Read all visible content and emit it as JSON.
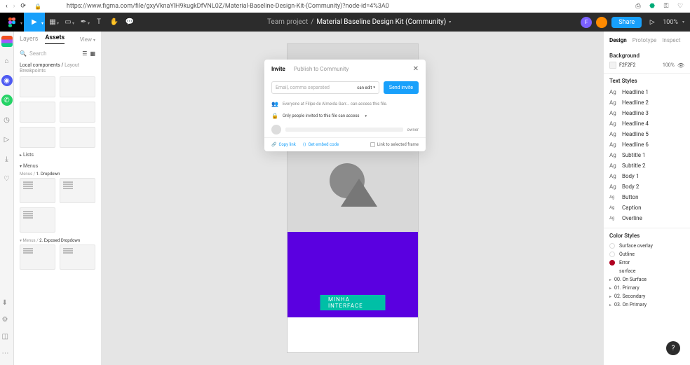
{
  "browser": {
    "url": "https://www.figma.com/file/gxyVknaYlH9kugkDfVNL0Z/Material-Baseline-Design-Kit-(Community)?node-id=4%3A0"
  },
  "figmaTop": {
    "project": "Team project",
    "sep": "/",
    "file": "Material Baseline Design Kit (Community)",
    "avatar_f": "F",
    "share": "Share",
    "zoom": "100%"
  },
  "leftPanel": {
    "tab_layers": "Layers",
    "tab_assets": "Assets",
    "view_label": "View",
    "search_placeholder": "Search",
    "breadcrumb_local": "Local components /",
    "breadcrumb_layout": "Layout Breakpoints",
    "lists_label": "Lists",
    "menus_label": "Menus",
    "bc_menus1": "Menus /",
    "bc_dd1": "1. Dropdown",
    "bc_menus2": "Menus /",
    "bc_dd2": "2. Exposed Dropdown"
  },
  "canvas": {
    "chip_text": "MINHA INTERFACE"
  },
  "rightPanel": {
    "tab_design": "Design",
    "tab_prototype": "Prototype",
    "tab_inspect": "Inspect",
    "bg_title": "Background",
    "bg_hex": "F2F2F2",
    "bg_pct": "100%",
    "text_styles_title": "Text Styles",
    "ts": [
      "Headline 1",
      "Headline 2",
      "Headline 3",
      "Headline 4",
      "Headline 5",
      "Headline 6",
      "Subtitle 1",
      "Subtitle 2",
      "Body 1",
      "Body 2",
      "Button",
      "Caption",
      "Overline"
    ],
    "color_styles_title": "Color Styles",
    "cs_overlay": "Surface overlay",
    "cs_outline": "Outline",
    "cs_error": "Error",
    "cs_surface": "surface",
    "folders": [
      "00. On Surface",
      "01. Primary",
      "02. Secondary",
      "03. On Primary"
    ]
  },
  "modal": {
    "tab_invite": "Invite",
    "tab_publish": "Publish to Community",
    "email_placeholder": "Email, comma separated",
    "perm_label": "can edit",
    "send_btn": "Send invite",
    "info_text": "Everyone at Filipe de Almeida Garr... can access this file.",
    "access_text": "Only people invited to this file can access",
    "owner": "owner",
    "copy_link": "Copy link",
    "embed": "Get embed code",
    "link_frame": "Link to selected frame"
  },
  "help": "?"
}
